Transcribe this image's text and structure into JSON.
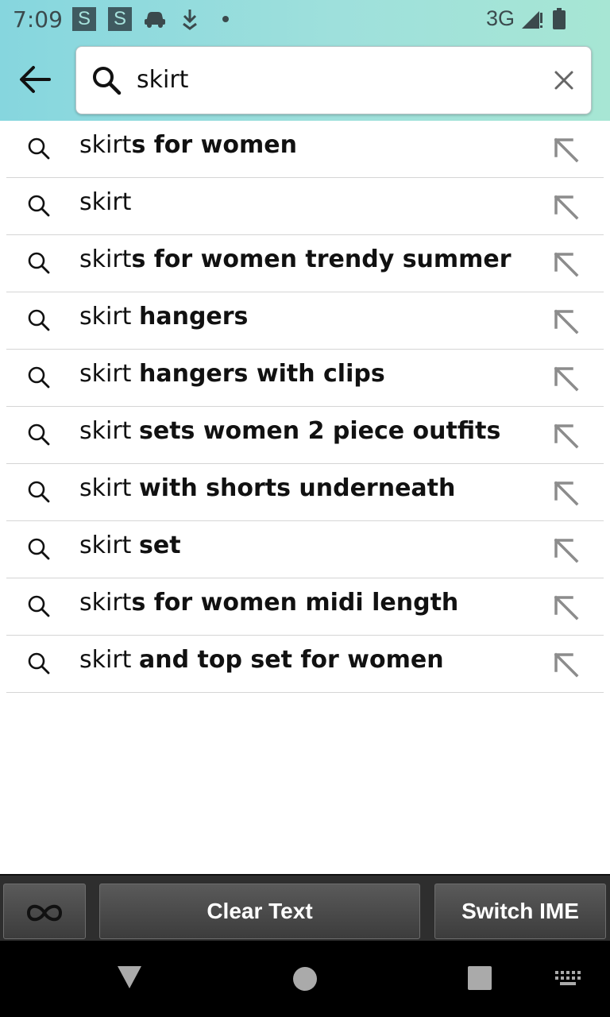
{
  "status_bar": {
    "time": "7:09",
    "badge_1": "S",
    "badge_2": "S",
    "network": "3G"
  },
  "search": {
    "query": "skirt",
    "placeholder": ""
  },
  "suggestions": [
    {
      "prefix": "skirt",
      "suffix": "s for women"
    },
    {
      "prefix": "skirt",
      "suffix": ""
    },
    {
      "prefix": "skirt",
      "suffix": "s for women trendy summer"
    },
    {
      "prefix": "skirt ",
      "suffix": "hangers"
    },
    {
      "prefix": "skirt ",
      "suffix": "hangers with clips"
    },
    {
      "prefix": "skirt ",
      "suffix": "sets women 2 piece outfits"
    },
    {
      "prefix": "skirt ",
      "suffix": "with shorts underneath"
    },
    {
      "prefix": "skirt ",
      "suffix": "set"
    },
    {
      "prefix": "skirt",
      "suffix": "s for women midi length"
    },
    {
      "prefix": "skirt ",
      "suffix": "and top set for women"
    }
  ],
  "bottom_bar": {
    "clear_label": "Clear Text",
    "switch_label": "Switch IME"
  },
  "icons": {
    "back": "arrow-left-icon",
    "search": "search-icon",
    "clear": "close-icon",
    "fill": "arrow-up-left-icon",
    "infinity": "infinity-icon",
    "nav_back": "triangle-down-icon",
    "nav_home": "circle-icon",
    "nav_recent": "square-icon",
    "keyboard": "keyboard-icon"
  },
  "colors": {
    "header_start": "#86d6de",
    "header_end": "#a7e6d4",
    "badge_bg": "#3f5a60",
    "bottom_bar": "#2e2e2e",
    "nav_bar": "#000000"
  }
}
